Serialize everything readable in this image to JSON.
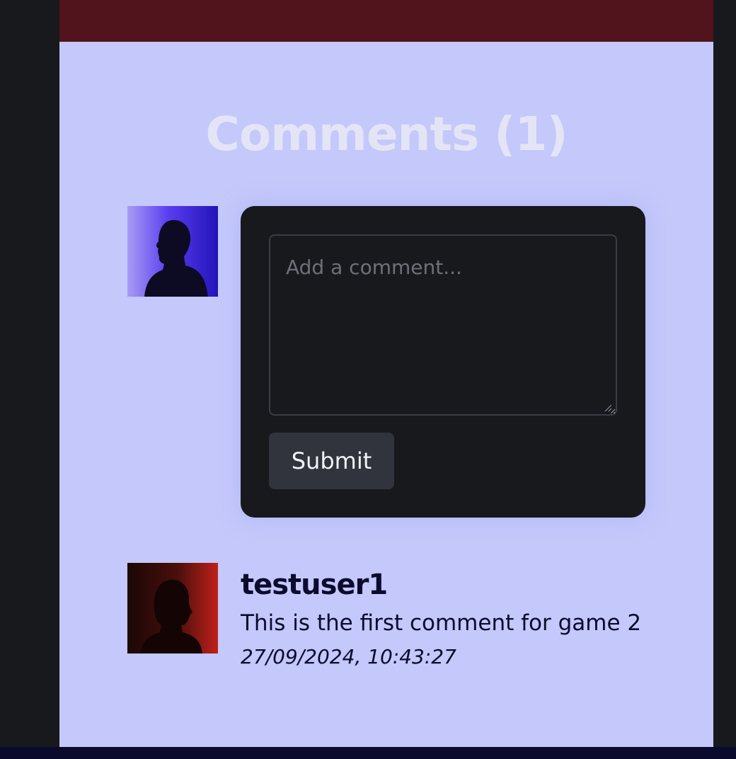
{
  "comments_section": {
    "title": "Comments (1)",
    "form": {
      "placeholder": "Add a comment...",
      "value": "",
      "submit_label": "Submit"
    },
    "comments": [
      {
        "author": "testuser1",
        "text": "This is the first comment for game 2",
        "timestamp": "27/09/2024, 10:43:27"
      }
    ]
  },
  "colors": {
    "page_background": "#18191d",
    "section_background": "#c4c8fa",
    "top_band": "#51131c",
    "bottom_band": "#0a0a2c",
    "form_card": "#18191d",
    "submit_button": "#31343d",
    "comment_text": "#0b0b2e",
    "title_text": "#e3e5f6"
  },
  "icons": {
    "current_user_avatar": "person-silhouette-blue",
    "comment_author_avatar": "person-silhouette-red"
  }
}
